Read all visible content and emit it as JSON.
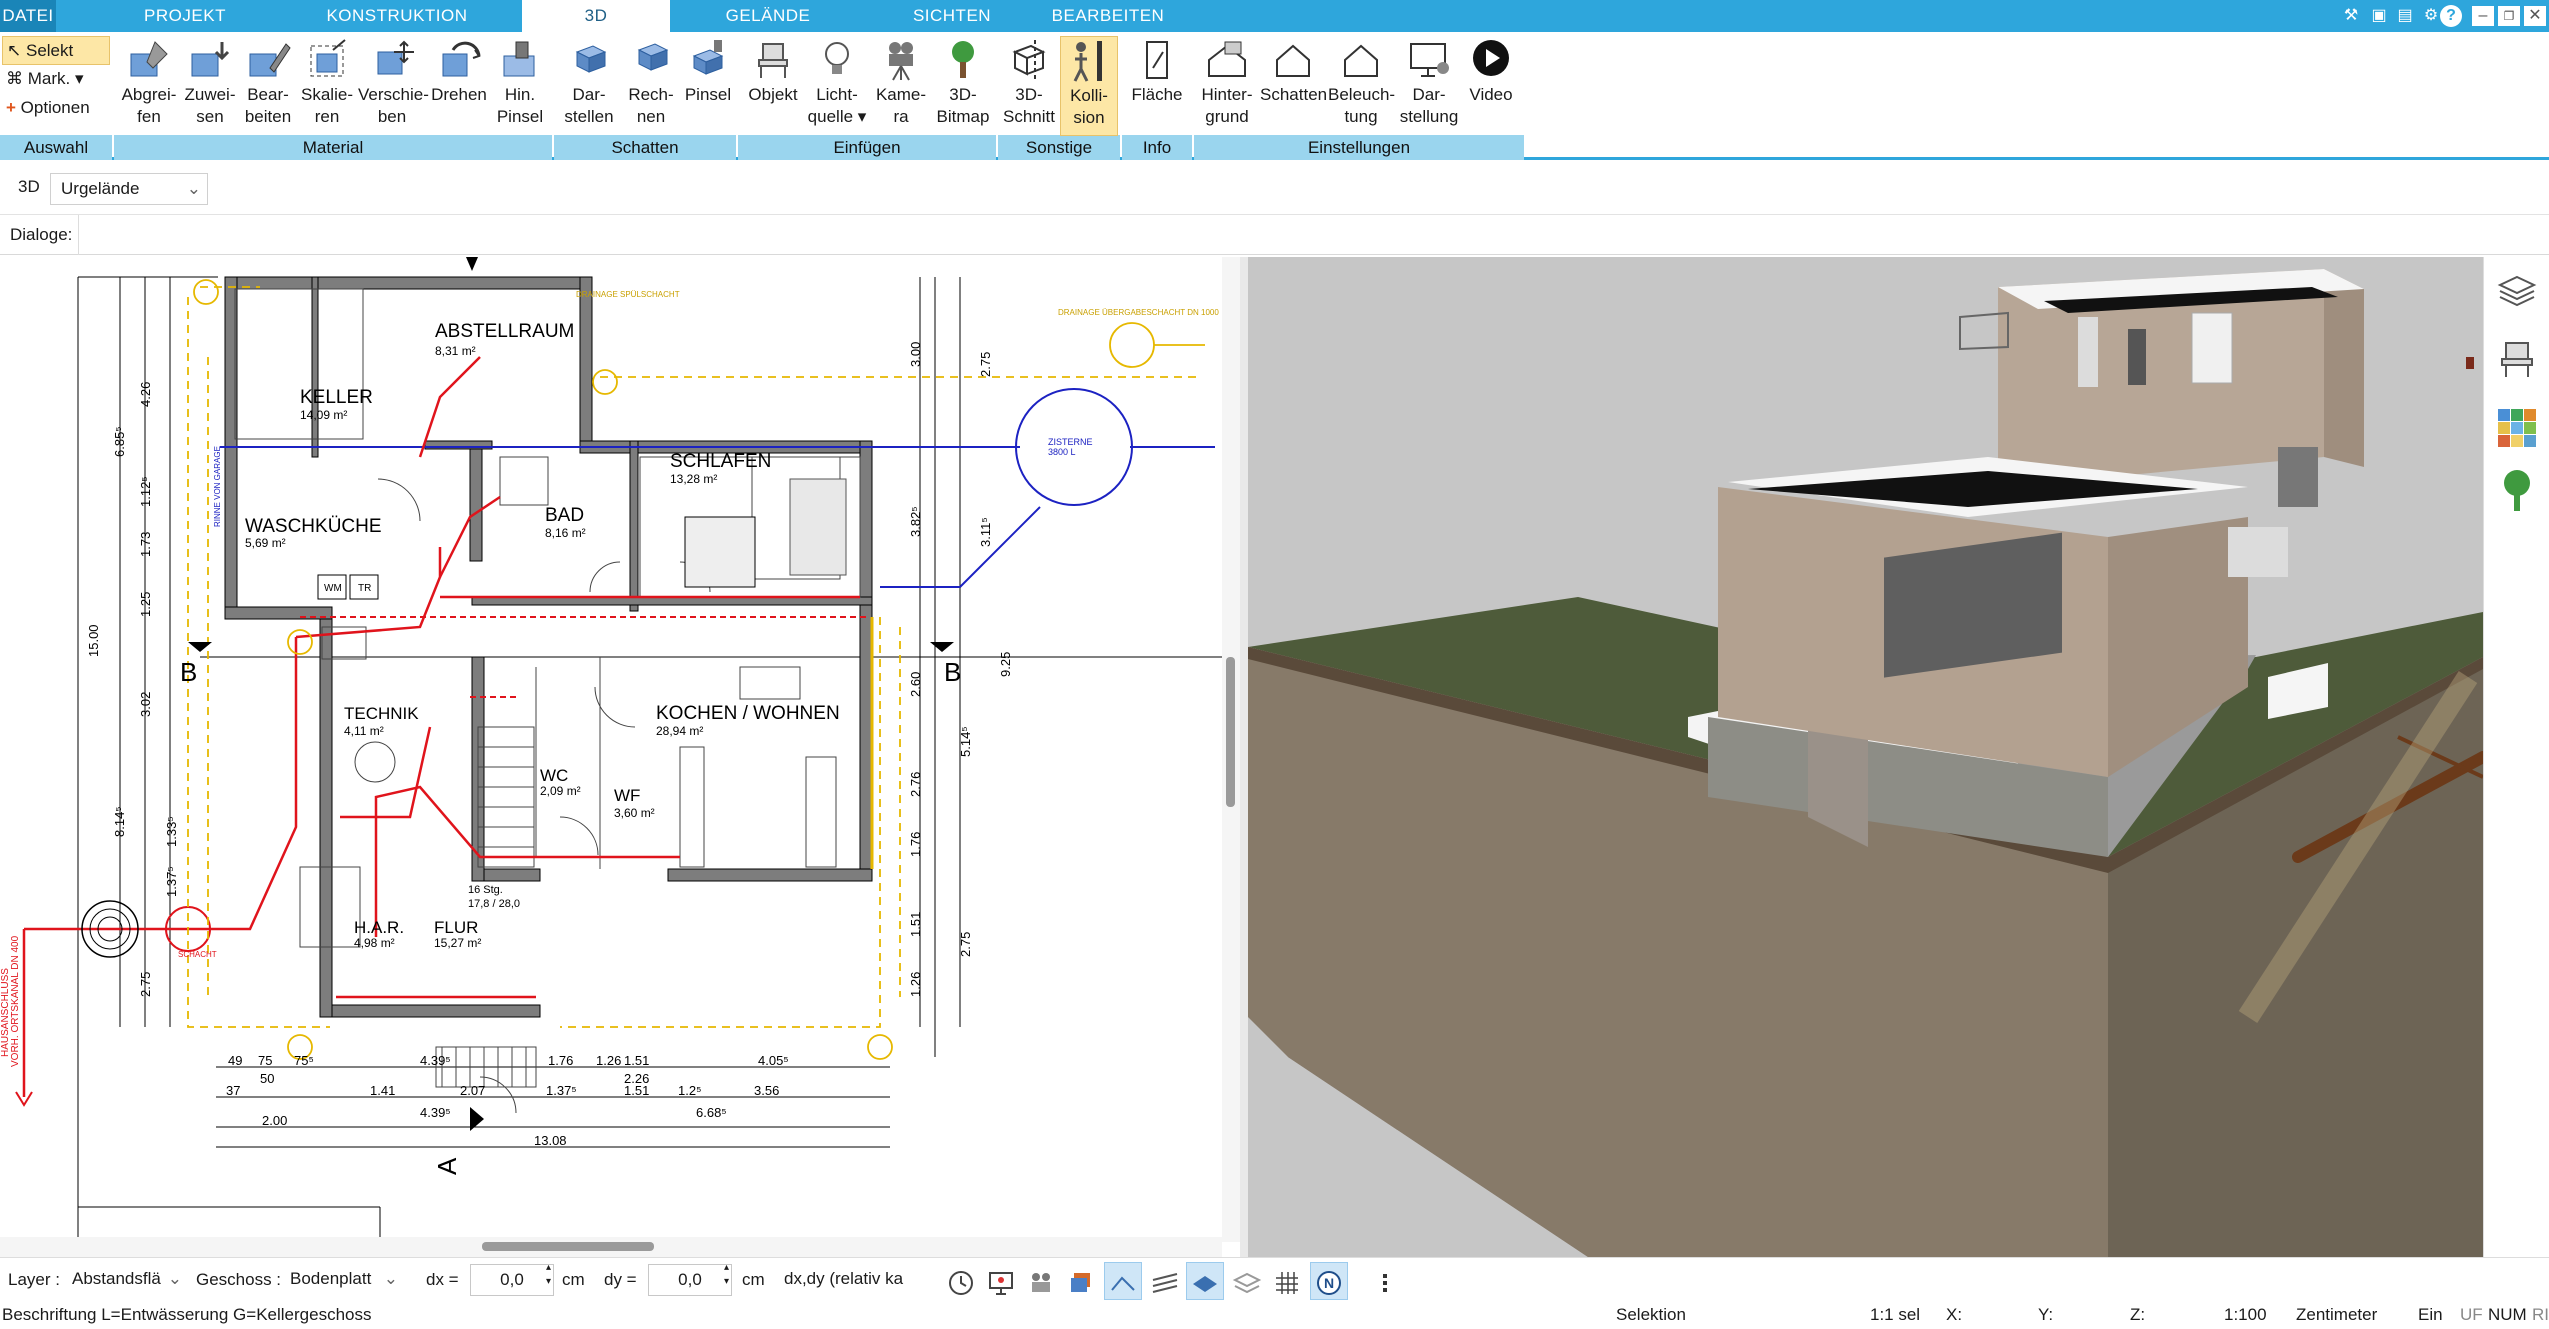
{
  "menu": {
    "tabs": [
      "DATEI",
      "PROJEKT",
      "KONSTRUKTION",
      "3D",
      "GELÄNDE",
      "SICHTEN",
      "BEARBEITEN"
    ],
    "active_tab": "3D"
  },
  "ribbon": {
    "auswahl": {
      "selekt": "Selekt",
      "mark": "Mark.",
      "optionen": "Optionen",
      "group": "Auswahl"
    },
    "material": {
      "buttons": [
        "Abgrei-\nfen",
        "Zuwei-\nsen",
        "Bear-\nbeiten",
        "Skalie-\nren",
        "Verschie-\nben",
        "Drehen",
        "Hin.\nPinsel"
      ],
      "group": "Material"
    },
    "schatten": {
      "buttons": [
        "Dar-\nstellen",
        "Rech-\nnen",
        "Pinsel"
      ],
      "group": "Schatten"
    },
    "einfuegen": {
      "buttons": [
        "Objekt",
        "Licht-\nquelle",
        "Kame-\nra",
        "3D-\nBitmap"
      ],
      "group": "Einfügen"
    },
    "sonstige": {
      "buttons": [
        "3D-\nSchnitt",
        "Kolli-\nsion"
      ],
      "group": "Sonstige"
    },
    "info": {
      "buttons": [
        "Fläche"
      ],
      "group": "Info"
    },
    "einstellungen": {
      "buttons": [
        "Hinter-\ngrund",
        "Schatten",
        "Beleuch-\ntung",
        "Dar-\nstellung",
        "Video"
      ],
      "group": "Einstellungen"
    }
  },
  "toolbar2": {
    "mode": "3D",
    "dropdown": "Urgelände"
  },
  "dialog_bar": {
    "label": "Dialoge:"
  },
  "plan": {
    "rooms": [
      {
        "name": "ABSTELLRAUM",
        "area": "8,31 m²"
      },
      {
        "name": "KELLER",
        "area": "14,09 m²"
      },
      {
        "name": "SCHLAFEN",
        "area": "13,28 m²"
      },
      {
        "name": "BAD",
        "area": "8,16 m²"
      },
      {
        "name": "WASCHKÜCHE",
        "area": "5,69 m²"
      },
      {
        "name": "TECHNIK",
        "area": "4,11 m²"
      },
      {
        "name": "KOCHEN / WOHNEN",
        "area": "28,94 m²"
      },
      {
        "name": "WC",
        "area": "2,09 m²"
      },
      {
        "name": "WF",
        "area": "3,60 m²"
      },
      {
        "name": "H.A.R.",
        "area": "4,98 m²"
      },
      {
        "name": "FLUR",
        "area": "15,27 m²"
      }
    ],
    "zisterne": [
      "ZISTERNE",
      "3800 L"
    ],
    "section_labels": [
      "B",
      "B",
      "A"
    ],
    "stairs": [
      "16 Stg.",
      "17,8 / 28,0"
    ],
    "small_labels": {
      "wm": "WM",
      "tr": "TR",
      "schacht": "SCHACHT",
      "kanal": "VORH. ORTSKANAL DN 400",
      "hausanschluss": "HAUSANSCHLUSS",
      "drainage": "DRAINAGE SPÜLSCHACHT",
      "drainage2": "DRAINAGE ÜBERGABESCHACHT DN 1000",
      "rinne": "RINNE VON GARAGE"
    },
    "dims_left": [
      "6.85⁵",
      "4.26",
      "1.73",
      "3.02",
      "15.00",
      "8.14⁵",
      "2.75",
      "1.33⁵",
      "1.25",
      "1.12⁵",
      "1.37⁵"
    ],
    "dims_right": [
      "3.00",
      "2.75",
      "3.82⁵",
      "3.11⁵",
      "9.25",
      "5.14⁵",
      "2.60",
      "2.76",
      "1.51",
      "2.75",
      "1.76",
      "1.26"
    ],
    "dims_bottom": [
      "49",
      "75",
      "75⁵",
      "4.39⁵",
      "1.76",
      "1.26",
      "1.51",
      "2.26",
      "4.05⁵",
      "37",
      "50",
      "1.41",
      "2.07",
      "1.37⁵",
      "1.51",
      "1.2⁵",
      "3.56",
      "2.00",
      "4.39⁵",
      "6.68⁵",
      "13.08"
    ]
  },
  "statusbar": {
    "layer_label": "Layer :",
    "layer_value": "Abstandsflä",
    "geschoss_label": "Geschoss :",
    "geschoss_value": "Bodenplatt",
    "dx_label": "dx =",
    "dx_value": "0,0",
    "dx_unit": "cm",
    "dy_label": "dy =",
    "dy_value": "0,0",
    "dy_unit": "cm",
    "coord_mode": "dx,dy (relativ ka"
  },
  "infobar": {
    "hint": "Beschriftung L=Entwässerung G=Kellergeschoss",
    "mode": "Selektion",
    "sel": "1:1 sel",
    "x": "X:",
    "y": "Y:",
    "z": "Z:",
    "scale": "1:100",
    "unit": "Zentimeter",
    "ein": "Ein",
    "uf": "UF",
    "num": "NUM",
    "ri": "RI"
  }
}
